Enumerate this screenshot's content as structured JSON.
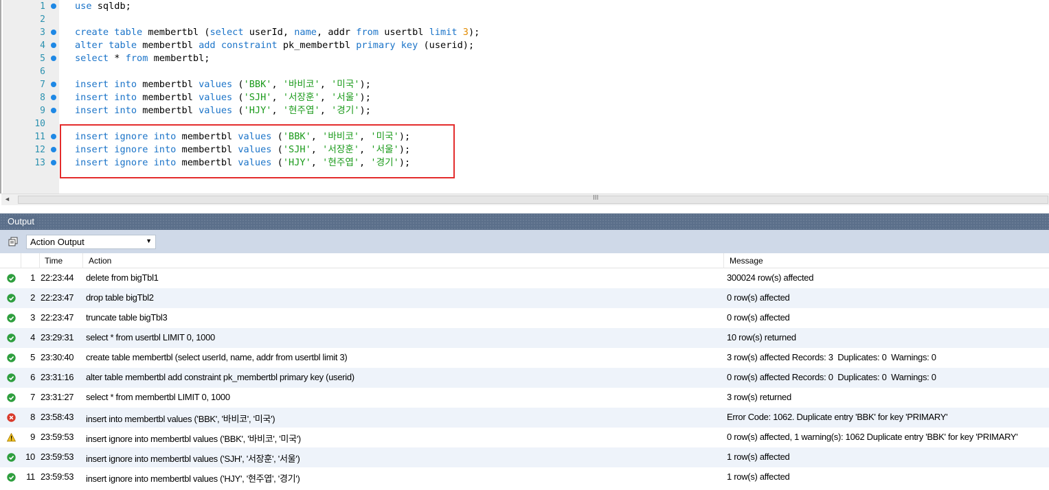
{
  "editor": {
    "lines": [
      {
        "n": "1",
        "marker": true,
        "tokens": [
          {
            "t": "use",
            "c": "kw"
          },
          {
            "t": " sqldb;"
          }
        ]
      },
      {
        "n": "2",
        "marker": false,
        "tokens": []
      },
      {
        "n": "3",
        "marker": true,
        "tokens": [
          {
            "t": "create",
            "c": "kw"
          },
          {
            "t": " "
          },
          {
            "t": "table",
            "c": "kw"
          },
          {
            "t": " membertbl ("
          },
          {
            "t": "select",
            "c": "kw"
          },
          {
            "t": " userId, "
          },
          {
            "t": "name",
            "c": "kw"
          },
          {
            "t": ", addr "
          },
          {
            "t": "from",
            "c": "kw"
          },
          {
            "t": " usertbl "
          },
          {
            "t": "limit",
            "c": "kw"
          },
          {
            "t": " "
          },
          {
            "t": "3",
            "c": "num"
          },
          {
            "t": ");"
          }
        ]
      },
      {
        "n": "4",
        "marker": true,
        "tokens": [
          {
            "t": "alter",
            "c": "kw"
          },
          {
            "t": " "
          },
          {
            "t": "table",
            "c": "kw"
          },
          {
            "t": " membertbl "
          },
          {
            "t": "add",
            "c": "kw"
          },
          {
            "t": " "
          },
          {
            "t": "constraint",
            "c": "kw"
          },
          {
            "t": " pk_membertbl "
          },
          {
            "t": "primary",
            "c": "kw"
          },
          {
            "t": " "
          },
          {
            "t": "key",
            "c": "kw"
          },
          {
            "t": " (userid);"
          }
        ]
      },
      {
        "n": "5",
        "marker": true,
        "tokens": [
          {
            "t": "select",
            "c": "kw"
          },
          {
            "t": " * "
          },
          {
            "t": "from",
            "c": "kw"
          },
          {
            "t": " membertbl;"
          }
        ]
      },
      {
        "n": "6",
        "marker": false,
        "tokens": []
      },
      {
        "n": "7",
        "marker": true,
        "tokens": [
          {
            "t": "insert",
            "c": "kw"
          },
          {
            "t": " "
          },
          {
            "t": "into",
            "c": "kw"
          },
          {
            "t": " membertbl "
          },
          {
            "t": "values",
            "c": "kw"
          },
          {
            "t": " ("
          },
          {
            "t": "'BBK'",
            "c": "str"
          },
          {
            "t": ", "
          },
          {
            "t": "'바비코'",
            "c": "str"
          },
          {
            "t": ", "
          },
          {
            "t": "'미국'",
            "c": "str"
          },
          {
            "t": ");"
          }
        ]
      },
      {
        "n": "8",
        "marker": true,
        "tokens": [
          {
            "t": "insert",
            "c": "kw"
          },
          {
            "t": " "
          },
          {
            "t": "into",
            "c": "kw"
          },
          {
            "t": " membertbl "
          },
          {
            "t": "values",
            "c": "kw"
          },
          {
            "t": " ("
          },
          {
            "t": "'SJH'",
            "c": "str"
          },
          {
            "t": ", "
          },
          {
            "t": "'서장훈'",
            "c": "str"
          },
          {
            "t": ", "
          },
          {
            "t": "'서울'",
            "c": "str"
          },
          {
            "t": ");"
          }
        ]
      },
      {
        "n": "9",
        "marker": true,
        "tokens": [
          {
            "t": "insert",
            "c": "kw"
          },
          {
            "t": " "
          },
          {
            "t": "into",
            "c": "kw"
          },
          {
            "t": " membertbl "
          },
          {
            "t": "values",
            "c": "kw"
          },
          {
            "t": " ("
          },
          {
            "t": "'HJY'",
            "c": "str"
          },
          {
            "t": ", "
          },
          {
            "t": "'현주엽'",
            "c": "str"
          },
          {
            "t": ", "
          },
          {
            "t": "'경기'",
            "c": "str"
          },
          {
            "t": ");"
          }
        ]
      },
      {
        "n": "10",
        "marker": false,
        "tokens": []
      },
      {
        "n": "11",
        "marker": true,
        "tokens": [
          {
            "t": "insert",
            "c": "kw"
          },
          {
            "t": " "
          },
          {
            "t": "ignore",
            "c": "kw"
          },
          {
            "t": " "
          },
          {
            "t": "into",
            "c": "kw"
          },
          {
            "t": " membertbl "
          },
          {
            "t": "values",
            "c": "kw"
          },
          {
            "t": " ("
          },
          {
            "t": "'BBK'",
            "c": "str"
          },
          {
            "t": ", "
          },
          {
            "t": "'바비코'",
            "c": "str"
          },
          {
            "t": ", "
          },
          {
            "t": "'미국'",
            "c": "str"
          },
          {
            "t": ");"
          }
        ]
      },
      {
        "n": "12",
        "marker": true,
        "tokens": [
          {
            "t": "insert",
            "c": "kw"
          },
          {
            "t": " "
          },
          {
            "t": "ignore",
            "c": "kw"
          },
          {
            "t": " "
          },
          {
            "t": "into",
            "c": "kw"
          },
          {
            "t": " membertbl "
          },
          {
            "t": "values",
            "c": "kw"
          },
          {
            "t": " ("
          },
          {
            "t": "'SJH'",
            "c": "str"
          },
          {
            "t": ", "
          },
          {
            "t": "'서장훈'",
            "c": "str"
          },
          {
            "t": ", "
          },
          {
            "t": "'서울'",
            "c": "str"
          },
          {
            "t": ");"
          }
        ]
      },
      {
        "n": "13",
        "marker": true,
        "tokens": [
          {
            "t": "insert",
            "c": "kw"
          },
          {
            "t": " "
          },
          {
            "t": "ignore",
            "c": "kw"
          },
          {
            "t": " "
          },
          {
            "t": "into",
            "c": "kw"
          },
          {
            "t": " membertbl "
          },
          {
            "t": "values",
            "c": "kw"
          },
          {
            "t": " ("
          },
          {
            "t": "'HJY'",
            "c": "str"
          },
          {
            "t": ", "
          },
          {
            "t": "'현주엽'",
            "c": "str"
          },
          {
            "t": ", "
          },
          {
            "t": "'경기'",
            "c": "str"
          },
          {
            "t": ");"
          }
        ]
      }
    ],
    "colors": {
      "keyword": "#1a73c8",
      "string": "#1a9a1a",
      "number": "#e28a00",
      "line_number": "#2b91af",
      "highlight_box": "#e32b2b"
    }
  },
  "scrollbar": {
    "left_arrow": "◄",
    "grip": "III"
  },
  "output": {
    "title": "Output",
    "selector": {
      "value": "Action Output",
      "arrow": "▼"
    },
    "columns": {
      "time": "Time",
      "action": "Action",
      "message": "Message"
    },
    "rows": [
      {
        "num": "1",
        "time": "22:23:44",
        "action": "delete from bigTbl1",
        "message": "300024 row(s) affected",
        "status": "ok"
      },
      {
        "num": "2",
        "time": "22:23:47",
        "action": "drop table bigTbl2",
        "message": "0 row(s) affected",
        "status": "ok"
      },
      {
        "num": "3",
        "time": "22:23:47",
        "action": "truncate table bigTbl3",
        "message": "0 row(s) affected",
        "status": "ok"
      },
      {
        "num": "4",
        "time": "23:29:31",
        "action": "select * from usertbl LIMIT 0, 1000",
        "message": "10 row(s) returned",
        "status": "ok"
      },
      {
        "num": "5",
        "time": "23:30:40",
        "action": "create table membertbl (select userId, name, addr from usertbl limit 3)",
        "message": "3 row(s) affected Records: 3  Duplicates: 0  Warnings: 0",
        "status": "ok"
      },
      {
        "num": "6",
        "time": "23:31:16",
        "action": "alter table membertbl add constraint pk_membertbl primary key (userid)",
        "message": "0 row(s) affected Records: 0  Duplicates: 0  Warnings: 0",
        "status": "ok"
      },
      {
        "num": "7",
        "time": "23:31:27",
        "action": "select * from membertbl LIMIT 0, 1000",
        "message": "3 row(s) returned",
        "status": "ok"
      },
      {
        "num": "8",
        "time": "23:58:43",
        "action": "insert into membertbl values ('BBK', '바비코', '미국')",
        "message": "Error Code: 1062. Duplicate entry 'BBK' for key 'PRIMARY'",
        "status": "error"
      },
      {
        "num": "9",
        "time": "23:59:53",
        "action": "insert ignore into membertbl values ('BBK', '바비코', '미국')",
        "message": "0 row(s) affected, 1 warning(s): 1062 Duplicate entry 'BBK' for key 'PRIMARY'",
        "status": "warning"
      },
      {
        "num": "10",
        "time": "23:59:53",
        "action": "insert ignore into membertbl values ('SJH', '서장훈', '서울')",
        "message": "1 row(s) affected",
        "status": "ok"
      },
      {
        "num": "11",
        "time": "23:59:53",
        "action": "insert ignore into membertbl values ('HJY', '현주엽', '경기')",
        "message": "1 row(s) affected",
        "status": "ok"
      }
    ],
    "colors": {
      "ok": "#2e9e3e",
      "error": "#d93a2b",
      "warning": "#f0c020",
      "header_bg": "#5b6f8a",
      "toolbar_bg": "#cfd9e8",
      "alt_row_bg": "#eef3fa"
    }
  }
}
